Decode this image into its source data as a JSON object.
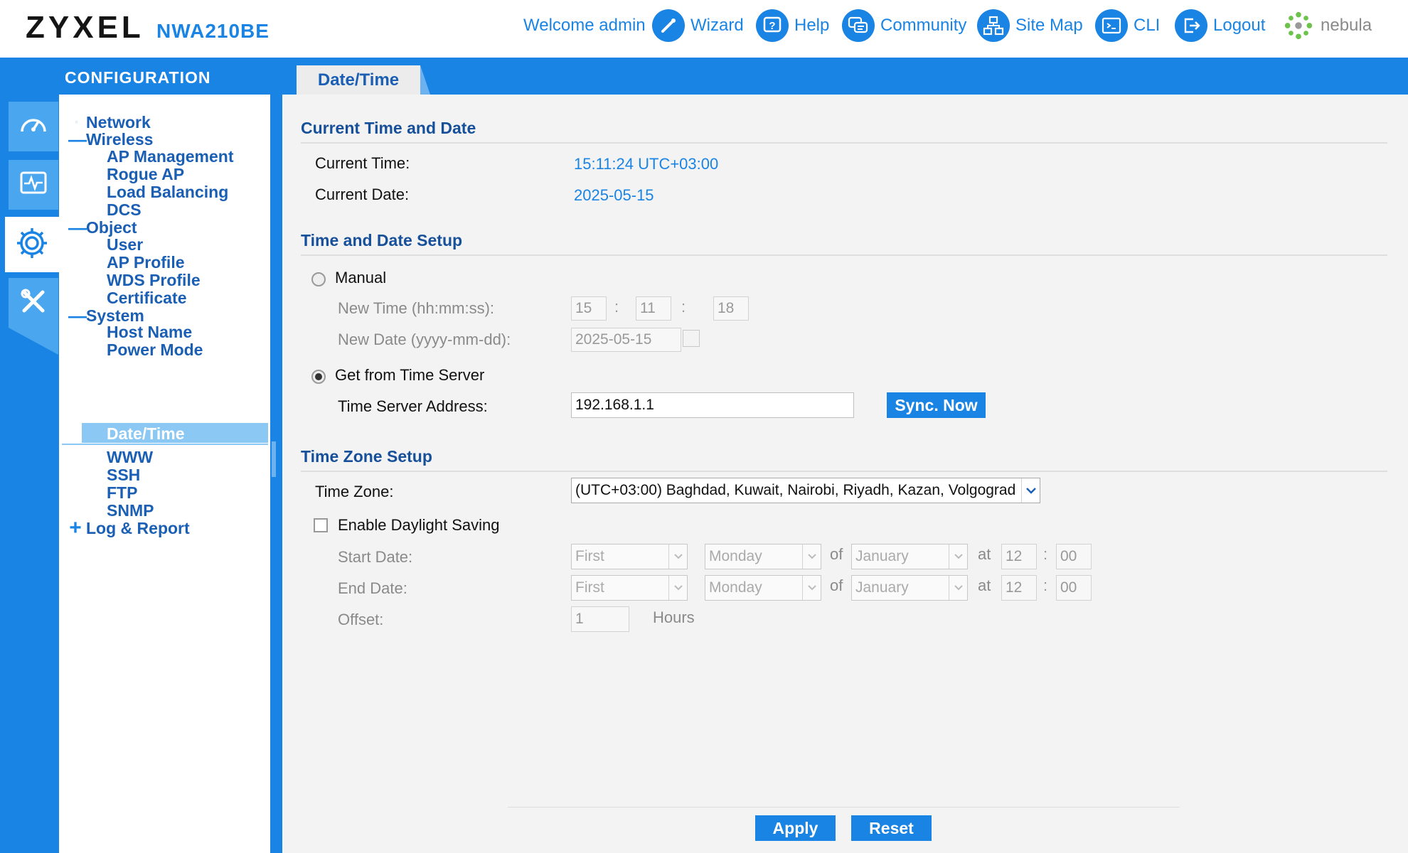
{
  "header": {
    "brand": "ZYXEL",
    "model": "NWA210BE",
    "welcome": "Welcome admin",
    "links": [
      {
        "label": "Wizard",
        "icon": "wand-icon"
      },
      {
        "label": "Help",
        "icon": "help-icon"
      },
      {
        "label": "Community",
        "icon": "chat-icon"
      },
      {
        "label": "Site Map",
        "icon": "sitemap-icon"
      },
      {
        "label": "CLI",
        "icon": "terminal-icon"
      },
      {
        "label": "Logout",
        "icon": "logout-icon"
      },
      {
        "label": "nebula",
        "icon": "nebula-logo-icon"
      }
    ]
  },
  "section_title": "CONFIGURATION",
  "active_tab": "Date/Time",
  "sidebar_icons": [
    "dashboard-icon",
    "monitor-icon",
    "configuration-gear-icon",
    "maintenance-tools-icon"
  ],
  "nav": {
    "network": "Network",
    "wireless": "Wireless",
    "ap_management": "AP Management",
    "rogue_ap": "Rogue AP",
    "load_balancing": "Load Balancing",
    "dcs": "DCS",
    "object": "Object",
    "user": "User",
    "ap_profile": "AP Profile",
    "wds_profile": "WDS Profile",
    "certificate": "Certificate",
    "system": "System",
    "host_name": "Host Name",
    "power_mode": "Power Mode",
    "date_time": "Date/Time",
    "www": "WWW",
    "ssh": "SSH",
    "ftp": "FTP",
    "snmp": "SNMP",
    "log_report": "Log & Report",
    "collapse_symbol": "—",
    "expand_symbol": "+"
  },
  "current": {
    "title": "Current Time and Date",
    "time_label": "Current Time:",
    "time_value": "15:11:24 UTC+03:00",
    "date_label": "Current Date:",
    "date_value": "2025-05-15"
  },
  "setup": {
    "title": "Time and Date Setup",
    "manual_label": "Manual",
    "new_time_label": "New Time (hh:mm:ss):",
    "hh": "15",
    "mm": "11",
    "ss": "18",
    "new_date_label": "New Date (yyyy-mm-dd):",
    "new_date": "2025-05-15",
    "server_label": "Get from Time Server",
    "server_address_label": "Time Server Address:",
    "server_address": "192.168.1.1",
    "sync_button": "Sync. Now",
    "selected_mode": "time_server"
  },
  "timezone": {
    "title": "Time Zone Setup",
    "tz_label": "Time Zone:",
    "tz_value": "(UTC+03:00) Baghdad, Kuwait, Nairobi, Riyadh, Kazan, Volgograd",
    "dst_label": "Enable Daylight Saving",
    "dst_enabled": false,
    "start_label": "Start Date:",
    "end_label": "End Date:",
    "offset_label": "Offset:",
    "week": "First",
    "day": "Monday",
    "of_label": "of",
    "month": "January",
    "at_label": "at",
    "hour": "12",
    "minute": "00",
    "offset": "1",
    "hours_label": "Hours"
  },
  "footer": {
    "apply": "Apply",
    "reset": "Reset"
  },
  "colors": {
    "accent": "#1a84e4",
    "nav_text": "#1a5fb4",
    "section_title": "#17509a",
    "selected_nav": "#8cc8f4"
  }
}
